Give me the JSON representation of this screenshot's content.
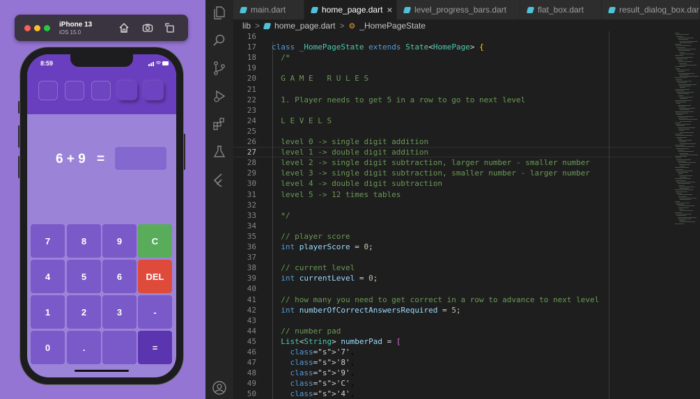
{
  "simulator": {
    "device_name": "iPhone 13",
    "os_version": "iOS 15.0",
    "home_icon": "home-icon",
    "screenshot_icon": "camera-icon",
    "rotate_icon": "rotate-icon"
  },
  "app": {
    "status_time": "8:59",
    "progress_boxes": 5,
    "question": "6 + 9",
    "equals": "=",
    "answer": "",
    "keypad": [
      "7",
      "8",
      "9",
      "C",
      "4",
      "5",
      "6",
      "DEL",
      "1",
      "2",
      "3",
      "-",
      "0",
      ".",
      "",
      "="
    ],
    "colors": {
      "accent": "#6a3fbf",
      "clear": "#58ac5a",
      "delete": "#df4b3b",
      "key": "#7a59c8",
      "background": "#9b84d8"
    }
  },
  "editor": {
    "tabs": [
      {
        "label": "main.dart",
        "active": false
      },
      {
        "label": "home_page.dart",
        "active": true,
        "close": "×"
      },
      {
        "label": "level_progress_bars.dart",
        "active": false
      },
      {
        "label": "flat_box.dart",
        "active": false
      },
      {
        "label": "result_dialog_box.dar",
        "active": false
      }
    ],
    "breadcrumb": {
      "folder": "lib",
      "sep": ">",
      "file": "home_page.dart",
      "symbol": "_HomePageState"
    },
    "current_line": "27",
    "lines": [
      {
        "n": "16",
        "t": ""
      },
      {
        "n": "17",
        "t": "class _HomePageState extends State<HomePage> {"
      },
      {
        "n": "18",
        "t": "  /*"
      },
      {
        "n": "19",
        "t": ""
      },
      {
        "n": "20",
        "t": "  G A M E   R U L E S"
      },
      {
        "n": "21",
        "t": ""
      },
      {
        "n": "22",
        "t": "  1. Player needs to get 5 in a row to go to next level"
      },
      {
        "n": "23",
        "t": ""
      },
      {
        "n": "24",
        "t": "  L E V E L S"
      },
      {
        "n": "25",
        "t": ""
      },
      {
        "n": "26",
        "t": "  level 0 -> single digit addition"
      },
      {
        "n": "27",
        "t": "  level 1 -> double digit addition"
      },
      {
        "n": "28",
        "t": "  level 2 -> single digit subtraction, larger number - smaller number"
      },
      {
        "n": "29",
        "t": "  level 3 -> single digit subtraction, smaller number - larger number"
      },
      {
        "n": "30",
        "t": "  level 4 -> double digit subtraction"
      },
      {
        "n": "31",
        "t": "  level 5 -> 12 times tables"
      },
      {
        "n": "32",
        "t": ""
      },
      {
        "n": "33",
        "t": "  */"
      },
      {
        "n": "34",
        "t": ""
      },
      {
        "n": "35",
        "t": "  // player score"
      },
      {
        "n": "36",
        "t": "  int playerScore = 0;"
      },
      {
        "n": "37",
        "t": ""
      },
      {
        "n": "38",
        "t": "  // current level"
      },
      {
        "n": "39",
        "t": "  int currentLevel = 0;"
      },
      {
        "n": "40",
        "t": ""
      },
      {
        "n": "41",
        "t": "  // how many you need to get correct in a row to advance to next level"
      },
      {
        "n": "42",
        "t": "  int numberOfCorrectAnswersRequired = 5;"
      },
      {
        "n": "43",
        "t": ""
      },
      {
        "n": "44",
        "t": "  // number pad"
      },
      {
        "n": "45",
        "t": "  List<String> numberPad = ["
      },
      {
        "n": "46",
        "t": "    '7',"
      },
      {
        "n": "47",
        "t": "    '8',"
      },
      {
        "n": "48",
        "t": "    '9',"
      },
      {
        "n": "49",
        "t": "    'C',"
      },
      {
        "n": "50",
        "t": "    '4',"
      }
    ],
    "activity_icons": [
      "files-icon",
      "search-icon",
      "source-control-icon",
      "run-debug-icon",
      "extensions-icon",
      "testing-icon",
      "flutter-icon",
      "account-icon"
    ]
  }
}
